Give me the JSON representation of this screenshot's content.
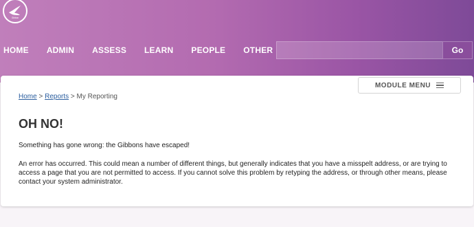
{
  "header": {
    "logo_text": "Gibbon"
  },
  "nav": {
    "items": [
      {
        "label": "HOME"
      },
      {
        "label": "ADMIN"
      },
      {
        "label": "ASSESS"
      },
      {
        "label": "LEARN"
      },
      {
        "label": "PEOPLE"
      },
      {
        "label": "OTHER"
      }
    ]
  },
  "search": {
    "value": "",
    "placeholder": "",
    "button_label": "Go"
  },
  "module_menu": {
    "label": "MODULE MENU",
    "icon": "hamburger-icon"
  },
  "breadcrumb": {
    "items": [
      "Home",
      "Reports",
      "My Reporting"
    ],
    "separator": ">"
  },
  "error": {
    "title": "OH NO!",
    "message": "Something has gone wrong: the Gibbons have escaped!",
    "detail": "An error has occurred. This could mean a number of different things, but generally indicates that you have a misspelt address, or are trying to access a page that you are not permitted to access. If you cannot solve this problem by retyping the address, or through other means, please contact your system administrator."
  },
  "colors": {
    "header_start": "#c07fbb",
    "header_end": "#7e4a98",
    "link": "#2a5d9e"
  }
}
